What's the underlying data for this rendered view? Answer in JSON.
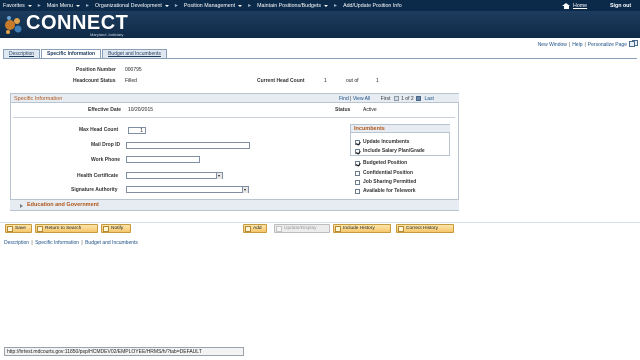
{
  "nav": {
    "items": [
      "Favorites",
      "Main Menu",
      "Organizational Development",
      "Position Management",
      "Maintain Positions/Budgets"
    ],
    "current": "Add/Update Position Info",
    "home": "Home",
    "signout": "Sign out"
  },
  "brand": {
    "name": "CONNECT",
    "sub": "Maryland Judiciary"
  },
  "toplinks": {
    "new_window": "New Window",
    "help": "Help",
    "personalize": "Personalize Page"
  },
  "tabs": [
    {
      "label": "Description",
      "active": false
    },
    {
      "label": "Specific Information",
      "active": true
    },
    {
      "label": "Budget and Incumbents",
      "active": false
    }
  ],
  "header": {
    "position_number_label": "Position Number",
    "position_number": "000795",
    "headcount_status_label": "Headcount Status",
    "headcount_status": "Filled",
    "current_head_count_label": "Current Head Count",
    "current_head_count": "1",
    "out_of_label": "out of",
    "out_of": "1"
  },
  "specific": {
    "title": "Specific Information",
    "find": "Find",
    "view_all": "View All",
    "first": "First",
    "range": "1 of 2",
    "last": "Last",
    "effective_date_label": "Effective Date",
    "effective_date": "10/20/2015",
    "status_label": "Status",
    "status": "Active",
    "max_head_count_label": "Max Head Count",
    "max_head_count": "1",
    "mail_drop_label": "Mail Drop ID",
    "mail_drop": "",
    "work_phone_label": "Work Phone",
    "work_phone": "",
    "health_cert_label": "Health Certificate",
    "health_cert": "",
    "signature_label": "Signature Authority",
    "signature": ""
  },
  "incumbents": {
    "title": "Incumbents",
    "checks": [
      {
        "label": "Update Incumbents",
        "checked": true
      },
      {
        "label": "Include Salary Plan/Grade",
        "checked": true
      }
    ]
  },
  "flags": [
    {
      "label": "Budgeted Position",
      "checked": true
    },
    {
      "label": "Confidential Position",
      "checked": false
    },
    {
      "label": "Job Sharing Permitted",
      "checked": false
    },
    {
      "label": "Available for Telework",
      "checked": false
    }
  ],
  "education": {
    "title": "Education and Government"
  },
  "buttons": {
    "save": "Save",
    "return": "Return to Search",
    "notify": "Notify",
    "add": "Add",
    "update": "Update/Display",
    "include_history": "Include History",
    "correct_history": "Correct History"
  },
  "bottom_links": [
    "Description",
    "Specific Information",
    "Budget and Incumbents"
  ],
  "status_url": "http://hrtest.mdcourts.gov:11850/psp/HCMDEV02/EMPLOYEE/HRMS/h/?tab=DEFAULT",
  "colors": {
    "nav_bg": "#0b2a4a",
    "accent": "#b0571a",
    "link": "#1b4f86"
  }
}
